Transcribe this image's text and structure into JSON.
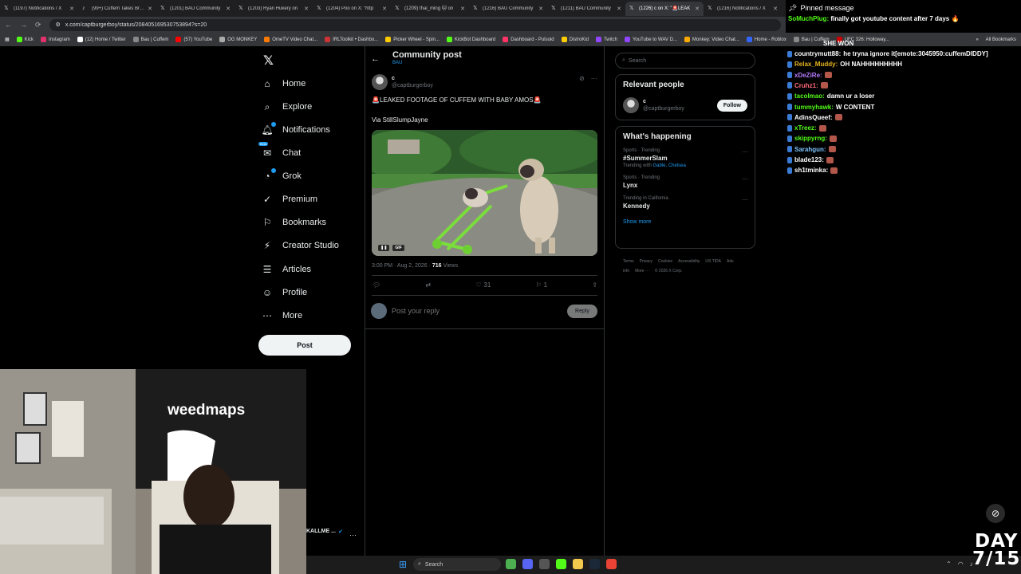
{
  "browser": {
    "tabs": [
      {
        "icon": "x-logo-icon",
        "title": "(1197) Notifications / X"
      },
      {
        "icon": "tiktok-icon",
        "title": "(99+) Cuffem Takes Bree"
      },
      {
        "icon": "x-logo-icon",
        "title": "(1201) BAU Community"
      },
      {
        "icon": "x-logo-icon",
        "title": "(1203) Ryan Hukery on"
      },
      {
        "icon": "x-logo-icon",
        "title": "(1204) Poo on X: \"http"
      },
      {
        "icon": "x-logo-icon",
        "title": "(1209) thai_ming 🐱 on"
      },
      {
        "icon": "x-logo-icon",
        "title": "(1216) BAU Community"
      },
      {
        "icon": "x-logo-icon",
        "title": "(1211) BAU Community"
      },
      {
        "icon": "x-logo-icon",
        "title": "(1226) c on X: \"🚨LEAK"
      },
      {
        "icon": "x-logo-icon",
        "title": "(1216) Notifications / X"
      }
    ],
    "url": "x.com/captburgerboy/status/208405169530753894?s=20",
    "bookmarks": [
      {
        "label": "Kick",
        "color": "#53fc18"
      },
      {
        "label": "Instagram",
        "color": "#e1306c"
      },
      {
        "label": "(12) Home / Twitter",
        "color": "#ffffff"
      },
      {
        "label": "Bau | Cuffem",
        "color": "#888888"
      },
      {
        "label": "(57) YouTube",
        "color": "#ff0000"
      },
      {
        "label": "OG MONKEY",
        "color": "#aaaaaa"
      },
      {
        "label": "OmeTV Video Chat...",
        "color": "#ff7a00"
      },
      {
        "label": "IRLToolkit • Dashbo...",
        "color": "#cc3333"
      },
      {
        "label": "Picker Wheel - Spin...",
        "color": "#ffcc00"
      },
      {
        "label": "KickBot Dashboard",
        "color": "#53fc18"
      },
      {
        "label": "Dashboard - Pulsoid",
        "color": "#ff3366"
      },
      {
        "label": "DistroKid",
        "color": "#ffcc00"
      },
      {
        "label": "Twitch",
        "color": "#9146ff"
      },
      {
        "label": "YouTube to WAV D...",
        "color": "#9146ff"
      },
      {
        "label": "Monkey: Video Chat...",
        "color": "#ffaa00"
      },
      {
        "label": "Home - Roblox",
        "color": "#3366ff"
      },
      {
        "label": "Bau | Cuffem",
        "color": "#888888"
      },
      {
        "label": "UFC 326: Holloway...",
        "color": "#cc0000"
      }
    ],
    "all_bookmarks": "All Bookmarks"
  },
  "nav": {
    "items": [
      {
        "label": "Home",
        "icon": "home-icon"
      },
      {
        "label": "Explore",
        "icon": "search-icon"
      },
      {
        "label": "Notifications",
        "icon": "bell-icon"
      },
      {
        "label": "Chat",
        "icon": "chat-icon"
      },
      {
        "label": "Grok",
        "icon": "grok-icon"
      },
      {
        "label": "Premium",
        "icon": "premium-icon"
      },
      {
        "label": "Bookmarks",
        "icon": "bookmark-icon"
      },
      {
        "label": "Creator Studio",
        "icon": "creator-studio-icon"
      },
      {
        "label": "Articles",
        "icon": "articles-icon"
      },
      {
        "label": "Profile",
        "icon": "profile-icon"
      },
      {
        "label": "More",
        "icon": "more-icon"
      }
    ],
    "chat_badge": "Beta",
    "post_button": "Post"
  },
  "post": {
    "header_title": "Community post",
    "header_sub": "BAU",
    "author_name": "c",
    "author_handle": "@captburgerboy",
    "text": "LEAKED FOOTAGE OF CUFFEM WITH BABY AMOS",
    "via": "Via StillSlumpJayne",
    "media_label": "GIF",
    "timestamp": "3:00 PM · Aug 2, 2026 · ",
    "views_count": "716",
    "views_label": "Views",
    "likes": "31",
    "bookmarks": "1",
    "reply_placeholder": "Post your reply",
    "reply_button": "Reply"
  },
  "sidebar": {
    "search_placeholder": "Search",
    "relevant_title": "Relevant people",
    "relevant_name": "c",
    "relevant_handle": "@captburgerboy",
    "follow": "Follow",
    "happening_title": "What's happening",
    "trends": [
      {
        "context": "Sports · Trending",
        "name": "#SummerSlam",
        "with_prefix": "Trending with ",
        "with": "Gable, Chelsea"
      },
      {
        "context": "Sports · Trending",
        "name": "Lynx",
        "with_prefix": "",
        "with": ""
      },
      {
        "context": "Trending in California",
        "name": "Kennedy",
        "with_prefix": "",
        "with": ""
      }
    ],
    "show_more": "Show more",
    "footer": [
      "Terms",
      "Privacy",
      "Cookies",
      "Accessibility",
      "US TIDA",
      "Ads info",
      "More ···",
      "© 2026 X Corp."
    ]
  },
  "chat": {
    "pinned_label": "Pinned message",
    "pinned_user": "SoMuchPlug:",
    "pinned_text": "finally got youtube content after 7 days",
    "top_partial": "SHE WON",
    "lines": [
      {
        "user": "countrymutt88:",
        "color": "#ffffff",
        "msg": "he tryna ignore it[emote:3045950:cuffemDIDDY]"
      },
      {
        "user": "Relax_Muddy:",
        "color": "#e6b422",
        "msg": "OH NAHHHHHHHHH"
      },
      {
        "user": "xDeZiRe:",
        "color": "#b77cff",
        "msg": ""
      },
      {
        "user": "Cruhz1:",
        "color": "#ff6a7a",
        "msg": ""
      },
      {
        "user": "tacolmao:",
        "color": "#53fc18",
        "msg": "damn ur a loser"
      },
      {
        "user": "tummyhawk:",
        "color": "#53fc18",
        "msg": "W CONTENT"
      },
      {
        "user": "AdinsQueef:",
        "color": "#ffffff",
        "msg": ""
      },
      {
        "user": "xTreez:",
        "color": "#53fc18",
        "msg": ""
      },
      {
        "user": "skippyrng:",
        "color": "#53fc18",
        "msg": ""
      },
      {
        "user": "Sarahgun:",
        "color": "#7cc3ff",
        "msg": ""
      },
      {
        "user": "blade123:",
        "color": "#ffffff",
        "msg": ""
      },
      {
        "user": "sh1tminka:",
        "color": "#ffffff",
        "msg": ""
      }
    ]
  },
  "webcam": {
    "banner": "weedmaps",
    "name": "KALLME ..."
  },
  "taskbar": {
    "search": "Search"
  },
  "overlay": {
    "day_line1": "DAY",
    "day_line2": "7/15"
  }
}
